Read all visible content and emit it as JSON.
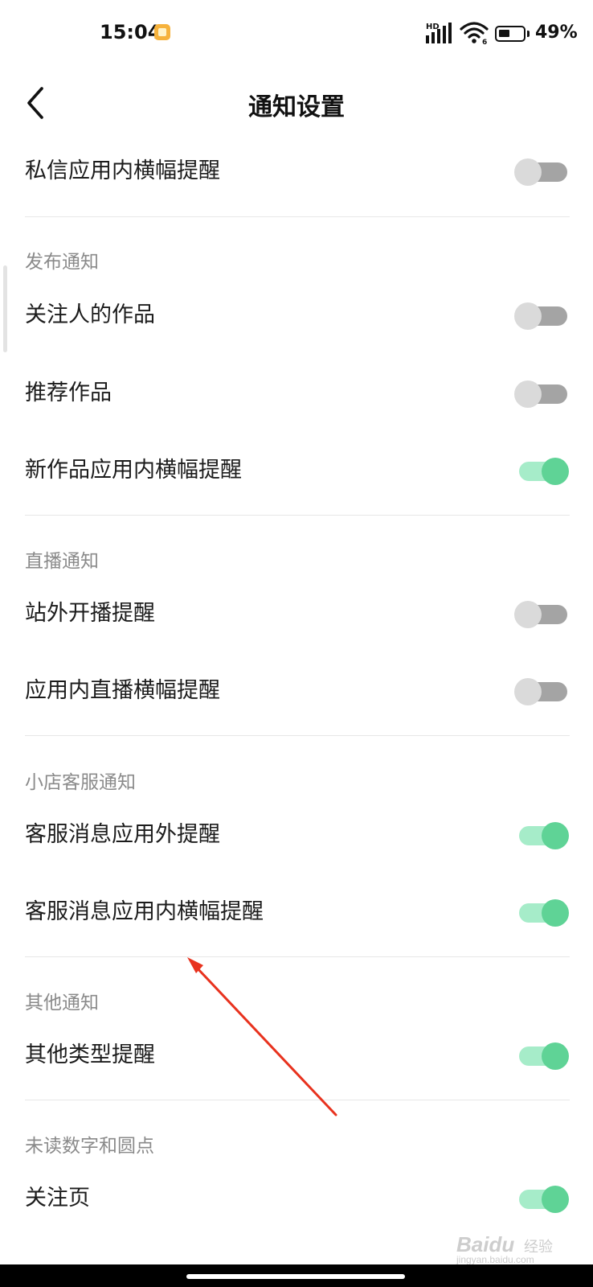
{
  "status_bar": {
    "time": "15:04",
    "network": "HD",
    "wifi_badge": "6",
    "battery_level": 49,
    "battery_text": "49%"
  },
  "header": {
    "title": "通知设置"
  },
  "rows": [
    {
      "label": "私信应用内横幅提醒",
      "on": false
    },
    {
      "label": "关注人的作品",
      "on": false
    },
    {
      "label": "推荐作品",
      "on": false
    },
    {
      "label": "新作品应用内横幅提醒",
      "on": true
    },
    {
      "label": "站外开播提醒",
      "on": false
    },
    {
      "label": "应用内直播横幅提醒",
      "on": false
    },
    {
      "label": "客服消息应用外提醒",
      "on": true
    },
    {
      "label": "客服消息应用内横幅提醒",
      "on": true
    },
    {
      "label": "其他类型提醒",
      "on": true
    },
    {
      "label": "关注页",
      "on": true
    }
  ],
  "sections": {
    "publish": "发布通知",
    "live": "直播通知",
    "shop": "小店客服通知",
    "other": "其他通知",
    "unread": "未读数字和圆点"
  },
  "watermark": {
    "logo": "Baidu",
    "jy": "经验",
    "url": "jingyan.baidu.com"
  },
  "colors": {
    "toggle_on_knob": "#5fd396",
    "toggle_on_track": "#a6ecc9",
    "toggle_off_knob": "#dadada",
    "toggle_off_track": "#a4a4a4",
    "annotation_arrow": "#e8321e"
  }
}
